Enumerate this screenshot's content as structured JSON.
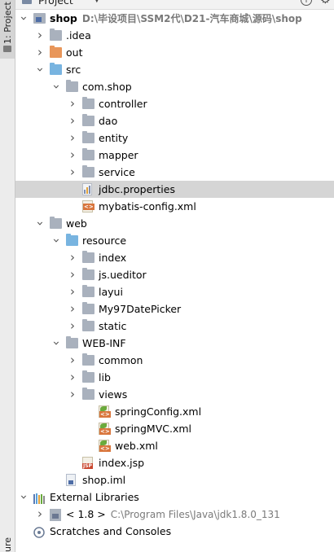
{
  "header": {
    "title": "Project"
  },
  "sidebar": {
    "project_tab": "1: Project",
    "bottom_tab": "ure"
  },
  "tree": [
    {
      "label": "shop",
      "path": "D:\\毕设项目\\SSM2代\\D21-汽车商城\\源码\\shop",
      "depth": 0,
      "chevron": "down",
      "icon": "module",
      "bold": true
    },
    {
      "label": ".idea",
      "depth": 1,
      "chevron": "right",
      "icon": "folder-gray"
    },
    {
      "label": "out",
      "depth": 1,
      "chevron": "right",
      "icon": "folder-orange"
    },
    {
      "label": "src",
      "depth": 1,
      "chevron": "down",
      "icon": "folder-blue"
    },
    {
      "label": "com.shop",
      "depth": 2,
      "chevron": "down",
      "icon": "folder-gray"
    },
    {
      "label": "controller",
      "depth": 3,
      "chevron": "right",
      "icon": "folder-gray"
    },
    {
      "label": "dao",
      "depth": 3,
      "chevron": "right",
      "icon": "folder-gray"
    },
    {
      "label": "entity",
      "depth": 3,
      "chevron": "right",
      "icon": "folder-gray"
    },
    {
      "label": "mapper",
      "depth": 3,
      "chevron": "right",
      "icon": "folder-gray"
    },
    {
      "label": "service",
      "depth": 3,
      "chevron": "right",
      "icon": "folder-gray"
    },
    {
      "label": "jdbc.properties",
      "depth": 3,
      "chevron": "none",
      "icon": "properties",
      "selected": true
    },
    {
      "label": "mybatis-config.xml",
      "depth": 3,
      "chevron": "none",
      "icon": "xml"
    },
    {
      "label": "web",
      "depth": 1,
      "chevron": "down",
      "icon": "folder-gray"
    },
    {
      "label": "resource",
      "depth": 2,
      "chevron": "down",
      "icon": "folder-blue"
    },
    {
      "label": "index",
      "depth": 3,
      "chevron": "right",
      "icon": "folder-gray"
    },
    {
      "label": "js.ueditor",
      "depth": 3,
      "chevron": "right",
      "icon": "folder-gray"
    },
    {
      "label": "layui",
      "depth": 3,
      "chevron": "right",
      "icon": "folder-gray"
    },
    {
      "label": "My97DatePicker",
      "depth": 3,
      "chevron": "right",
      "icon": "folder-gray"
    },
    {
      "label": "static",
      "depth": 3,
      "chevron": "right",
      "icon": "folder-gray"
    },
    {
      "label": "WEB-INF",
      "depth": 2,
      "chevron": "down",
      "icon": "folder-gray"
    },
    {
      "label": "common",
      "depth": 3,
      "chevron": "right",
      "icon": "folder-gray"
    },
    {
      "label": "lib",
      "depth": 3,
      "chevron": "right",
      "icon": "folder-gray"
    },
    {
      "label": "views",
      "depth": 3,
      "chevron": "right",
      "icon": "folder-gray"
    },
    {
      "label": "springConfig.xml",
      "depth": 4,
      "chevron": "none",
      "icon": "spring-xml"
    },
    {
      "label": "springMVC.xml",
      "depth": 4,
      "chevron": "none",
      "icon": "spring-xml"
    },
    {
      "label": "web.xml",
      "depth": 4,
      "chevron": "none",
      "icon": "spring-xml"
    },
    {
      "label": "index.jsp",
      "depth": 3,
      "chevron": "none",
      "icon": "jsp"
    },
    {
      "label": "shop.iml",
      "depth": 2,
      "chevron": "none",
      "icon": "iml"
    },
    {
      "label": "External Libraries",
      "depth": 0,
      "chevron": "down",
      "icon": "libraries"
    },
    {
      "label": "< 1.8 >",
      "path": "C:\\Program Files\\Java\\jdk1.8.0_131",
      "depth": 1,
      "chevron": "right",
      "icon": "jdk"
    },
    {
      "label": "Scratches and Consoles",
      "depth": 0,
      "chevron": "none",
      "icon": "scratches"
    }
  ],
  "colors": {
    "selection": "#d5d5d5",
    "folder_gray": "#a9b1bd",
    "folder_orange": "#e8965a",
    "folder_blue": "#78b4e0",
    "path_text": "#7a7a7a"
  }
}
